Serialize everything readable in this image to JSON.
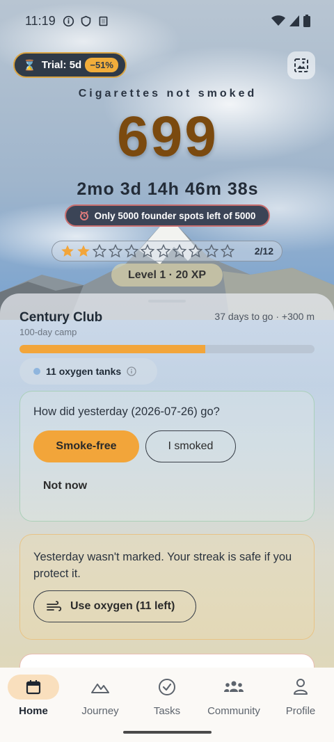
{
  "status_bar": {
    "time": "11:19"
  },
  "trial": {
    "label": "Trial: 5d",
    "discount": "−51%"
  },
  "hero": {
    "label": "Cigarettes not smoked",
    "count": "699",
    "duration": "2mo 3d 14h 46m 38s",
    "founder_text": "Only 5000 founder spots left of 5000"
  },
  "stars": {
    "filled": 2,
    "total": 12,
    "count_label": "2/12"
  },
  "level": {
    "label": "Level 1 · 20 XP"
  },
  "goal": {
    "title": "Century Club",
    "subtitle": "100-day camp",
    "meta": "37 days to go · +300 m",
    "progress_fraction": 0.63
  },
  "oxygen": {
    "label": "11 oxygen tanks"
  },
  "checkin": {
    "question": "How did yesterday (2026-07-26) go?",
    "smoke_free_label": "Smoke-free",
    "smoked_label": "I smoked",
    "not_now_label": "Not now"
  },
  "streak": {
    "text": "Yesterday wasn't marked. Your streak is safe if you protect it.",
    "button_label": "Use oxygen (11 left)"
  },
  "nav": {
    "items": [
      {
        "label": "Home",
        "icon": "calendar-icon"
      },
      {
        "label": "Journey",
        "icon": "mountain-icon"
      },
      {
        "label": "Tasks",
        "icon": "check-circle-icon"
      },
      {
        "label": "Community",
        "icon": "group-icon"
      },
      {
        "label": "Profile",
        "icon": "person-icon"
      }
    ],
    "active": "Home"
  },
  "colors": {
    "accent": "#f2a53a",
    "hero_number": "#7b4a0f",
    "pill_dark": "#2f3a48"
  }
}
